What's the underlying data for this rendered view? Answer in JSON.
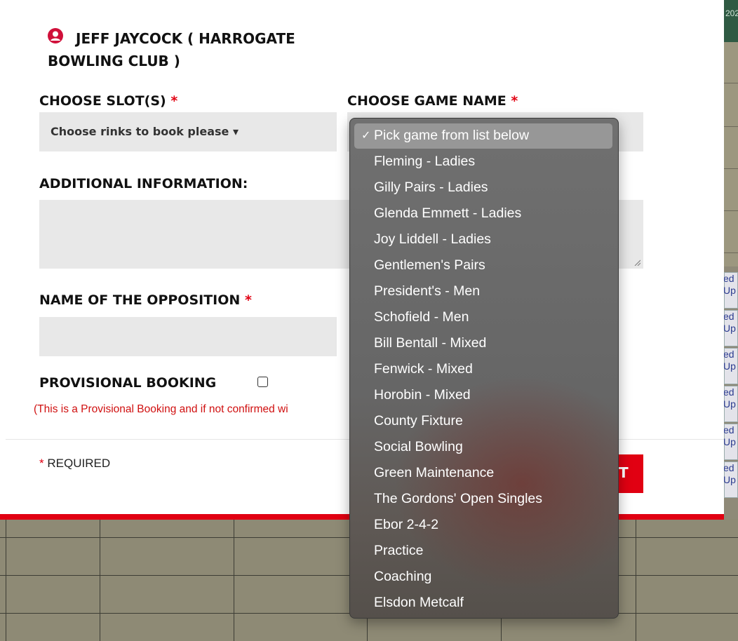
{
  "background": {
    "corner_text": "202",
    "tags": [
      {
        "line1": "ed",
        "line2": "Up"
      },
      {
        "line1": "ed",
        "line2": "Up"
      },
      {
        "line1": "ed",
        "line2": "Up"
      },
      {
        "line1": "ed",
        "line2": "Up"
      },
      {
        "line1": "ed",
        "line2": "Up"
      },
      {
        "line1": "ed",
        "line2": "Up"
      }
    ]
  },
  "colors": {
    "accent_red": "#e10012",
    "field_bg": "#e8e8e8",
    "dropdown_bg": "#676767"
  },
  "user": {
    "icon": "user-icon",
    "name": "JEFF JAYCOCK   ( HARROGATE BOWLING CLUB )"
  },
  "form": {
    "slots_label": "CHOOSE SLOT(S)",
    "slots_button": "Choose rinks to book please ▾",
    "game_label": "CHOOSE GAME NAME",
    "additional_label": "ADDITIONAL INFORMATION:",
    "opposition_label": "NAME OF THE OPPOSITION",
    "provisional_label": "PROVISIONAL BOOKING",
    "provisional_checked": false,
    "notice": "(This is a Provisional Booking and if not confirmed wi",
    "required_star": "*",
    "required_note": "REQUIRED",
    "submit_partial": "T"
  },
  "dropdown": {
    "selected": "Pick game from list below",
    "checkmark": "✓",
    "options": [
      "Pick game from list below",
      "Fleming - Ladies",
      "Gilly Pairs - Ladies",
      "Glenda Emmett - Ladies",
      "Joy Liddell - Ladies",
      "Gentlemen's Pairs",
      "President's - Men",
      "Schofield - Men",
      "Bill Bentall - Mixed",
      "Fenwick - Mixed",
      "Horobin - Mixed",
      "County Fixture",
      "Social Bowling",
      "Green Maintenance",
      "The Gordons' Open Singles",
      "Ebor 2-4-2",
      "Practice",
      "Coaching",
      "Elsdon Metcalf"
    ]
  }
}
